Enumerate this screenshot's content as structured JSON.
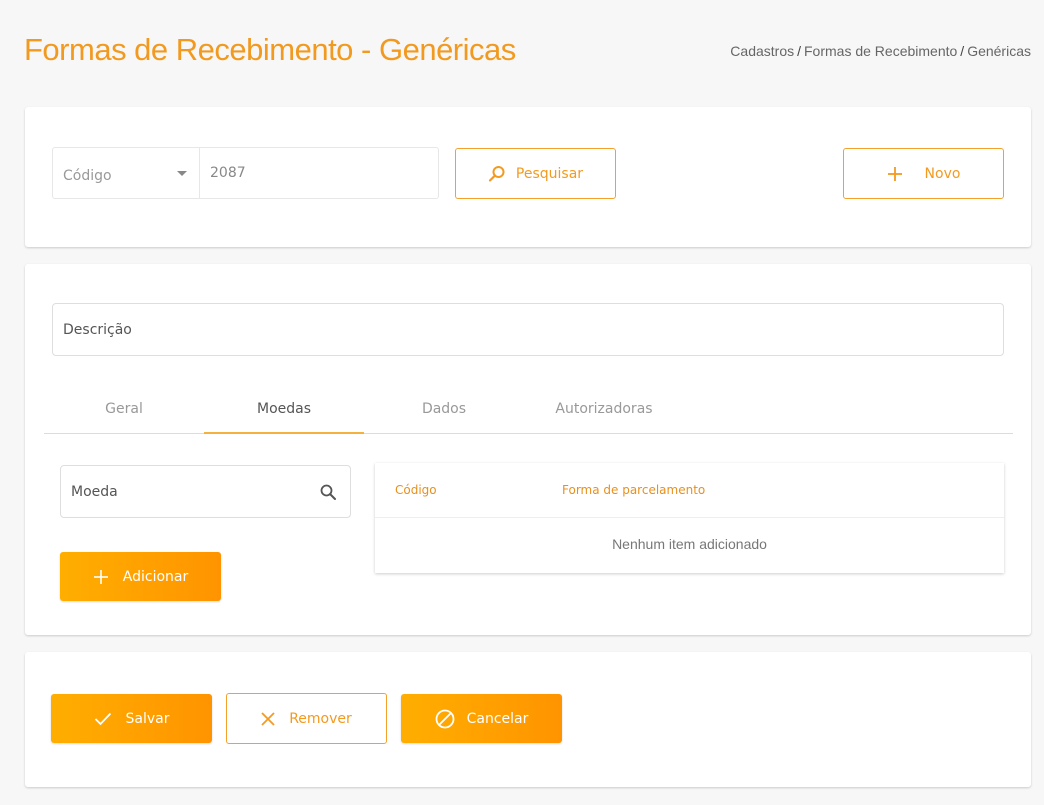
{
  "header": {
    "title": "Formas de Recebimento - Genéricas",
    "breadcrumb": [
      "Cadastros",
      "Formas de Recebimento",
      "Genéricas"
    ],
    "breadcrumb_separator": "/"
  },
  "search": {
    "filter_label": "Código",
    "code_value": "2087",
    "search_label": "Pesquisar",
    "new_label": "Novo"
  },
  "form": {
    "description_placeholder": "Descrição",
    "tabs": [
      {
        "label": "Geral",
        "active": false
      },
      {
        "label": "Moedas",
        "active": true
      },
      {
        "label": "Dados",
        "active": false
      },
      {
        "label": "Autorizadoras",
        "active": false
      }
    ],
    "currency_placeholder": "Moeda",
    "add_label": "Adicionar",
    "table": {
      "columns": [
        "Código",
        "Forma de parcelamento"
      ],
      "empty_message": "Nenhum item adicionado"
    }
  },
  "actions": {
    "save_label": "Salvar",
    "remove_label": "Remover",
    "cancel_label": "Cancelar"
  },
  "colors": {
    "accent": "#f29a1f",
    "button_gradient_start": "#ffae00",
    "button_gradient_end": "#ff9400"
  },
  "icons": {
    "search": "magnifier-icon",
    "new": "plus-icon",
    "add": "plus-icon",
    "save": "check-icon",
    "remove": "x-icon",
    "cancel": "ban-icon"
  }
}
